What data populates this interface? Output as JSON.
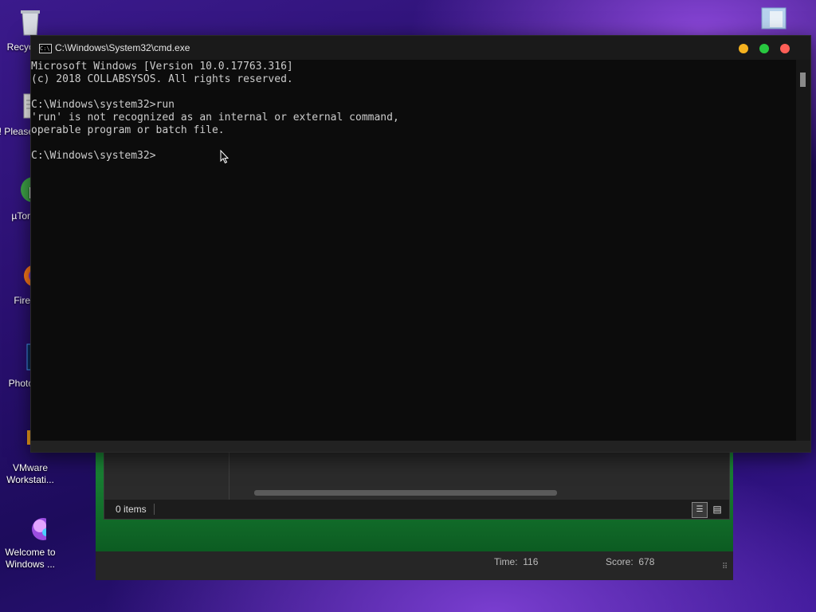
{
  "desktop": {
    "icons": [
      {
        "label": "Recyc",
        "icon": "recycle-bin-icon"
      },
      {
        "label": "! Please",
        "icon": "notepad-icon"
      },
      {
        "label": "µTor",
        "icon": "utorrent-icon"
      },
      {
        "label": "Fire",
        "icon": "firefox-icon"
      },
      {
        "label": "Photo",
        "icon": "photoshop-icon"
      },
      {
        "label_line1": "VMware",
        "label_line2": "Workstati...",
        "icon": "vmware-icon"
      },
      {
        "label_line1": "Welcome to",
        "label_line2": "Windows ...",
        "icon": "welcome-icon"
      }
    ],
    "top_right_icon": "folder-icon"
  },
  "background_window": {
    "status_text": "0 items",
    "time_label": "Time:",
    "time_value": "116",
    "score_label": "Score:",
    "score_value": "678"
  },
  "cmd": {
    "title": "C:\\Windows\\System32\\cmd.exe",
    "lines": [
      "Microsoft Windows [Version 10.0.17763.316]",
      "(c) 2018 COLLABSYSOS. All rights reserved.",
      "",
      "C:\\Windows\\system32>run",
      "'run' is not recognized as an internal or external command,",
      "operable program or batch file.",
      "",
      "C:\\Windows\\system32>"
    ]
  },
  "colors": {
    "console_text": "#cccccc",
    "console_bg": "#0c0c0c",
    "minimize": "#f5b21f",
    "maximize": "#28c840",
    "close": "#ff5f57"
  }
}
